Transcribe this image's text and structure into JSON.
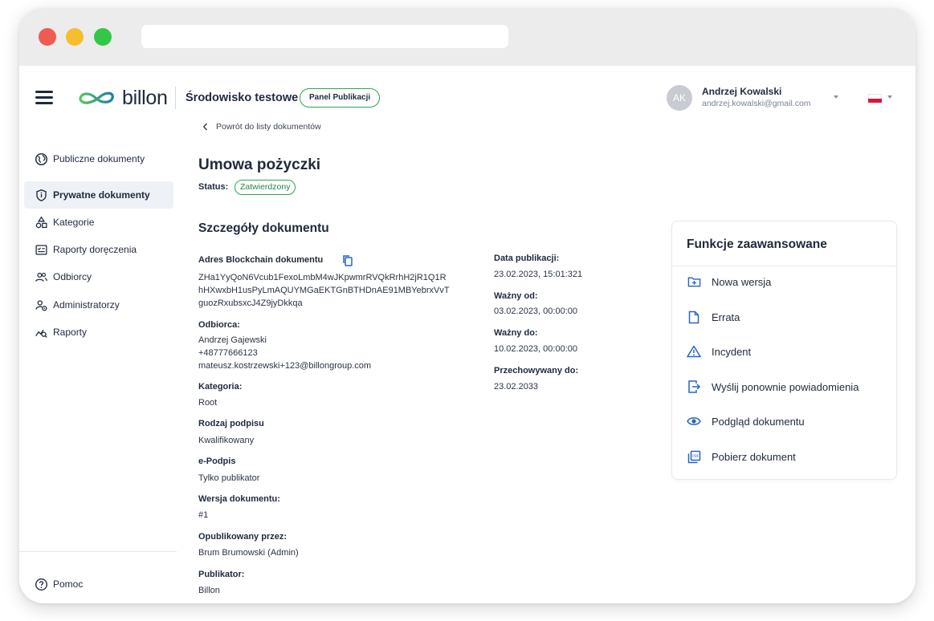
{
  "header": {
    "logo_text": "billon",
    "environment": "Środowisko testowe",
    "panel_badge": "Panel Publikacji",
    "user": {
      "initials": "AK",
      "name": "Andrzej Kowalski",
      "email": "andrzej.kowalski@gmail.com"
    }
  },
  "sidebar": {
    "items": [
      {
        "label": "Publiczne dokumenty",
        "icon": "globe-icon"
      },
      {
        "label": "Prywatne dokumenty",
        "icon": "shield-icon"
      },
      {
        "label": "Kategorie",
        "icon": "categories-icon"
      },
      {
        "label": "Raporty doręczenia",
        "icon": "delivery-report-icon"
      },
      {
        "label": "Odbiorcy",
        "icon": "users-icon"
      },
      {
        "label": "Administratorzy",
        "icon": "admin-icon"
      },
      {
        "label": "Raporty",
        "icon": "reports-icon"
      }
    ],
    "active_item": "Prywatne dokumenty",
    "help_label": "Pomoc"
  },
  "main": {
    "back_link": "Powrót do listy dokumentów",
    "title": "Umowa pożyczki",
    "status_label": "Status:",
    "status_value": "Zatwierdzony",
    "section_title": "Szczegóły dokumentu",
    "fields_left": {
      "blockchain_label": "Adres Blockchain dokumentu",
      "blockchain_line1": "ZHa1YyQoN6Vcub1FexoLmbM4wJKpwmrRVQkRrhH2jR1Q1R",
      "blockchain_line2": "hHXwxbH1usPyLmAQUYMGaEKTGnBTHDnAE91MBYebrxVvT",
      "blockchain_line3": "guozRxubsxcJ4Z9jyDkkqa",
      "recipient_label": "Odbiorca:",
      "recipient_name": "Andrzej Gajewski",
      "recipient_phone": "+48777666123",
      "recipient_email": "mateusz.kostrzewski+123@billongroup.com",
      "category_label": "Kategoria:",
      "category_value": "Root",
      "signature_type_label": "Rodzaj podpisu",
      "signature_type_value": "Kwalifikowany",
      "esign_label": "e-Podpis",
      "esign_value": "Tylko publikator",
      "version_label": "Wersja dokumentu:",
      "version_value": "#1",
      "published_by_label": "Opublikowany przez:",
      "published_by_value": "Brum Brumowski (Admin)",
      "publisher_label": "Publikator:",
      "publisher_value": "Billon"
    },
    "fields_right": {
      "publication_date_label": "Data publikacji:",
      "publication_date_value": "23.02.2023, 15:01:321",
      "valid_from_label": "Ważny od:",
      "valid_from_value": "03.02.2023, 00:00:00",
      "valid_to_label": "Ważny do:",
      "valid_to_value": "10.02.2023, 00:00:00",
      "stored_until_label": "Przechowywany do:",
      "stored_until_value": "23.02.2033"
    }
  },
  "advanced": {
    "title": "Funkcje zaawansowane",
    "items": [
      {
        "label": "Nowa wersja",
        "icon": "new-folder-icon"
      },
      {
        "label": "Errata",
        "icon": "document-icon"
      },
      {
        "label": "Incydent",
        "icon": "warning-icon"
      },
      {
        "label": "Wyślij ponownie powiadomienia",
        "icon": "resend-icon"
      },
      {
        "label": "Podgląd dokumentu",
        "icon": "eye-icon"
      },
      {
        "label": "Pobierz dokument",
        "icon": "download-pdf-icon"
      }
    ]
  },
  "colors": {
    "accent_blue": "#2563c9",
    "brand_green": "#2ea44f",
    "text_dark": "#1f2a3c",
    "active_bg": "#eef2f7"
  }
}
